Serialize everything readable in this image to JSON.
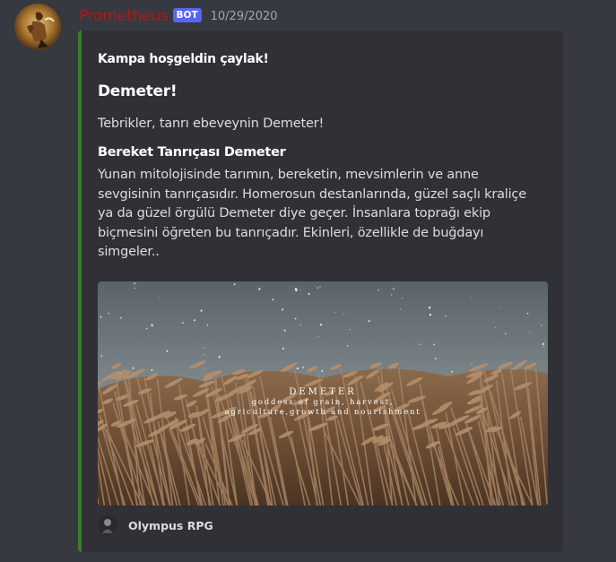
{
  "message": {
    "username": "Prometheus",
    "bot_tag": "BOT",
    "timestamp": "10/29/2020",
    "username_color": "#b3161b"
  },
  "embed": {
    "accent_color": "#3d7d2e",
    "author": "Kampa hoşgeldin çaylak!",
    "title": "Demeter!",
    "description": "Tebrikler, tanrı ebeveynin Demeter!",
    "field": {
      "name": "Bereket Tanrıçası Demeter",
      "value_lines": [
        "Yunan mitolojisinde tarımın, bereketin, mevsimlerin ve anne",
        "sevgisinin tanrıçasıdır. Homerosun destanlarında, güzel saçlı kraliçe",
        "ya da güzel örgülü Demeter diye geçer. İnsanlara toprağı ekip",
        "biçmesini öğreten bu tanrıçadır. Ekinleri, özellikle de buğdayı",
        "simgeler.."
      ]
    },
    "image": {
      "caption_title": "DEMETER",
      "caption_lines": [
        "goddess of grain, harvest,",
        "agriculture,growth and nourishment"
      ]
    },
    "footer": {
      "text": "Olympus RPG",
      "icon": "olympus-rpg-icon"
    }
  }
}
